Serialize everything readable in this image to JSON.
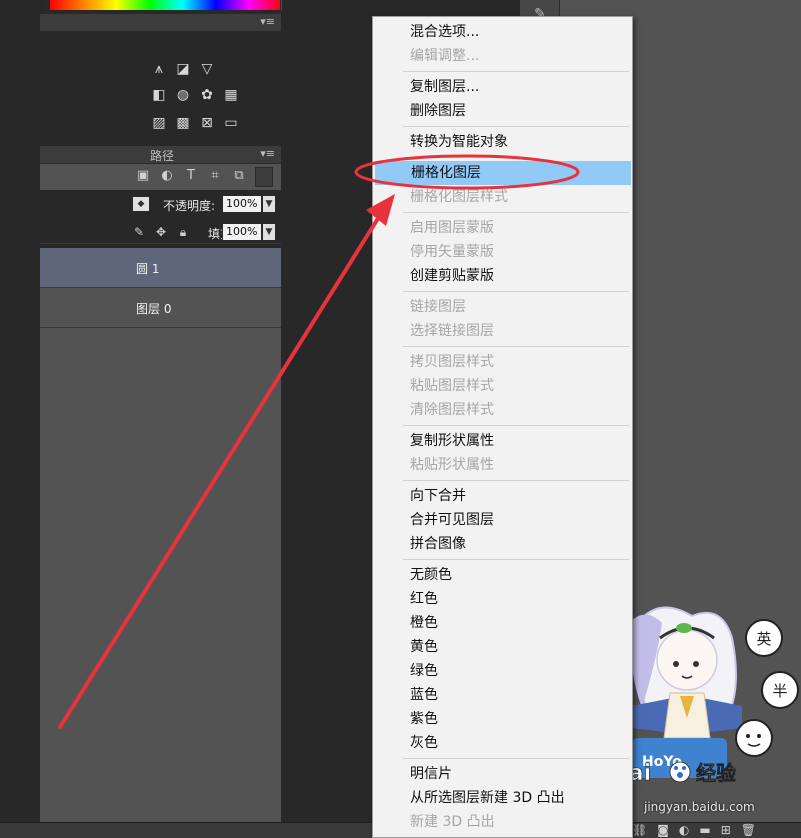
{
  "menu": {
    "items": [
      {
        "label": "混合选项...",
        "enabled": true
      },
      {
        "label": "编辑调整...",
        "enabled": false
      },
      {
        "label": "复制图层...",
        "enabled": true
      },
      {
        "label": "删除图层",
        "enabled": true
      },
      {
        "label": "转换为智能对象",
        "enabled": true
      },
      {
        "label": "栅格化图层",
        "enabled": true,
        "highlighted": true
      },
      {
        "label": "栅格化图层样式",
        "enabled": false
      },
      {
        "label": "启用图层蒙版",
        "enabled": false
      },
      {
        "label": "停用矢量蒙版",
        "enabled": false
      },
      {
        "label": "创建剪贴蒙版",
        "enabled": true
      },
      {
        "label": "链接图层",
        "enabled": false
      },
      {
        "label": "选择链接图层",
        "enabled": false
      },
      {
        "label": "拷贝图层样式",
        "enabled": false
      },
      {
        "label": "粘贴图层样式",
        "enabled": false
      },
      {
        "label": "清除图层样式",
        "enabled": false
      },
      {
        "label": "复制形状属性",
        "enabled": true
      },
      {
        "label": "粘贴形状属性",
        "enabled": false
      },
      {
        "label": "向下合并",
        "enabled": true
      },
      {
        "label": "合并可见图层",
        "enabled": true
      },
      {
        "label": "拼合图像",
        "enabled": true
      },
      {
        "label": "无颜色",
        "enabled": true
      },
      {
        "label": "红色",
        "enabled": true
      },
      {
        "label": "橙色",
        "enabled": true
      },
      {
        "label": "黄色",
        "enabled": true
      },
      {
        "label": "绿色",
        "enabled": true
      },
      {
        "label": "蓝色",
        "enabled": true
      },
      {
        "label": "紫色",
        "enabled": true
      },
      {
        "label": "灰色",
        "enabled": true
      },
      {
        "label": "明信片",
        "enabled": true
      },
      {
        "label": "从所选图层新建 3D 凸出",
        "enabled": true
      },
      {
        "label": "新建 3D 凸出",
        "enabled": false
      }
    ]
  },
  "layers_panel": {
    "paths_tab": "路径",
    "opacity_label": "不透明度:",
    "opacity_value": "100%",
    "fill_label": "填充:",
    "fill_value": "100%",
    "layers": [
      {
        "name": "圆 1",
        "selected": true
      },
      {
        "name": "图层 0",
        "selected": false
      }
    ]
  },
  "watermark": {
    "bubble_1": "英",
    "bubble_2": "半",
    "banner": "HoYo",
    "site_brand": "Bai",
    "site_brand_cn": "经验",
    "site_url": "jingyan.baidu.com"
  },
  "colors": {
    "menu_highlight": "#91c9f7",
    "annotation_red": "#e8323c",
    "selected_layer": "#5d6779"
  }
}
